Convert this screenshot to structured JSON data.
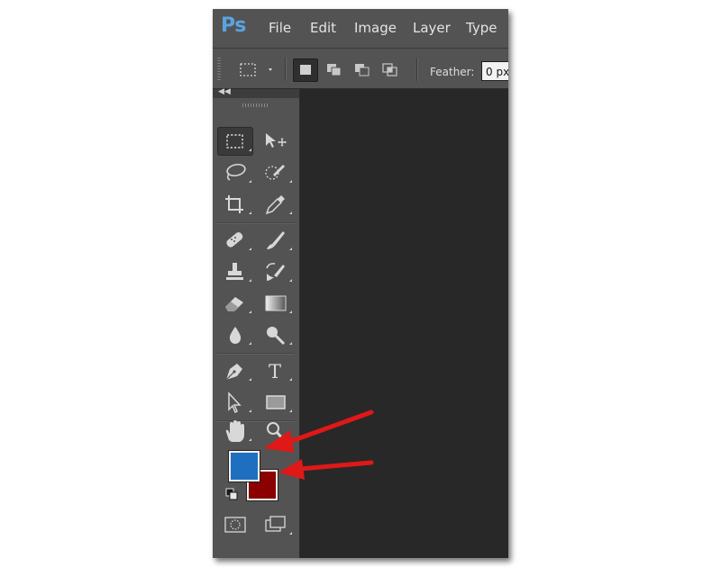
{
  "app": {
    "logo": "Ps",
    "menu": [
      "File",
      "Edit",
      "Image",
      "Layer",
      "Type"
    ]
  },
  "options_bar": {
    "feather_label": "Feather:",
    "feather_value": "0 px"
  },
  "toolbar": {
    "tools": [
      "rectangular-marquee-tool",
      "move-tool",
      "lasso-tool",
      "quick-selection-tool",
      "crop-tool",
      "eyedropper-tool",
      "spot-healing-brush-tool",
      "brush-tool",
      "clone-stamp-tool",
      "history-brush-tool",
      "eraser-tool",
      "gradient-tool",
      "blur-tool",
      "dodge-tool",
      "pen-tool",
      "type-tool",
      "path-selection-tool",
      "rectangle-tool",
      "hand-tool",
      "zoom-tool"
    ],
    "type_tool_glyph": "T"
  },
  "colors": {
    "foreground": "#1f6fc1",
    "background": "#8b0000",
    "annotation_arrow": "#e01818"
  }
}
